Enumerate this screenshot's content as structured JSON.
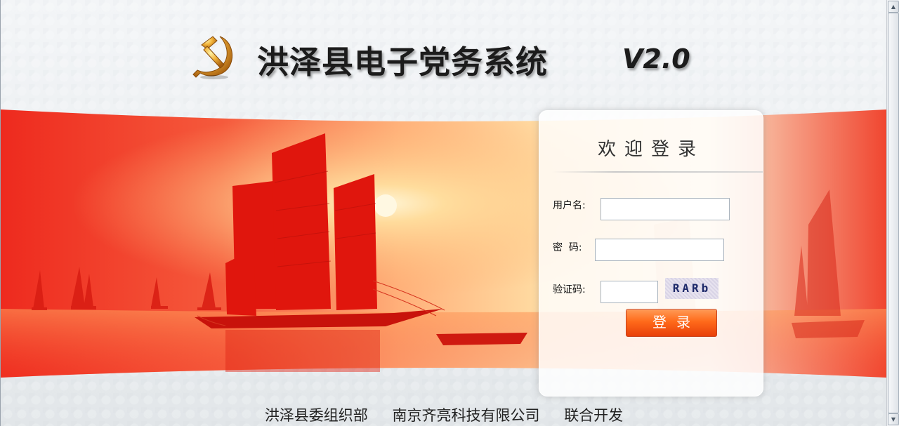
{
  "header": {
    "title": "洪泽县电子党务系统",
    "version": "V2.0",
    "logo_icon": "party-emblem-icon"
  },
  "login": {
    "title": "欢迎登录",
    "username_label": "用户名:",
    "password_label": "密  码:",
    "captcha_label": "验证码:",
    "captcha_text": "RARb",
    "login_button": "登录",
    "username_value": "",
    "password_value": "",
    "captcha_value": ""
  },
  "footer": {
    "org1": "洪泽县委组织部",
    "org2": "南京齐亮科技有限公司",
    "note": "联合开发"
  },
  "colors": {
    "banner_red": "#f2392b",
    "banner_sun": "#ffd28a",
    "button_orange": "#ff6a1a",
    "gold": "#e0a12a"
  }
}
